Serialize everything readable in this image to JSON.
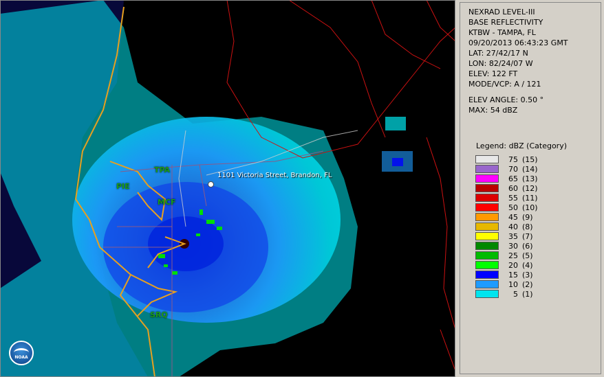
{
  "info": {
    "line1": "NEXRAD LEVEL-III",
    "line2": "BASE REFLECTIVITY",
    "line3": "KTBW - TAMPA, FL",
    "line4": "09/20/2013 06:43:23 GMT",
    "line5": "LAT: 27/42/17 N",
    "line6": "LON: 82/24/07 W",
    "line7": "ELEV: 122 FT",
    "line8": "MODE/VCP: A / 121",
    "line9": "ELEV ANGLE: 0.50 °",
    "line10": "MAX: 54 dBZ"
  },
  "legend": {
    "title": "Legend: dBZ (Category)",
    "items": [
      {
        "value": "75",
        "cat": "(15)",
        "color": "#e8e8e8"
      },
      {
        "value": "70",
        "cat": "(14)",
        "color": "#9966cc"
      },
      {
        "value": "65",
        "cat": "(13)",
        "color": "#ff00ff"
      },
      {
        "value": "60",
        "cat": "(12)",
        "color": "#bb0000"
      },
      {
        "value": "55",
        "cat": "(11)",
        "color": "#dd0000"
      },
      {
        "value": "50",
        "cat": "(10)",
        "color": "#ff0000"
      },
      {
        "value": "45",
        "cat": "(9)",
        "color": "#ff9900"
      },
      {
        "value": "40",
        "cat": "(8)",
        "color": "#e6b800"
      },
      {
        "value": "35",
        "cat": "(7)",
        "color": "#ffff00"
      },
      {
        "value": "30",
        "cat": "(6)",
        "color": "#008800"
      },
      {
        "value": "25",
        "cat": "(5)",
        "color": "#00bb00"
      },
      {
        "value": "20",
        "cat": "(4)",
        "color": "#00ff00"
      },
      {
        "value": "15",
        "cat": "(3)",
        "color": "#0000ff"
      },
      {
        "value": "10",
        "cat": "(2)",
        "color": "#1e9bff"
      },
      {
        "value": "5",
        "cat": "(1)",
        "color": "#00e5ee"
      }
    ]
  },
  "map": {
    "address": "1101 Victoria Street, Brandon, FL",
    "sites": {
      "tpa": "TPA",
      "pie": "PIE",
      "mcf": "MCF",
      "srq": "SRQ"
    },
    "logo": "NOAA"
  }
}
